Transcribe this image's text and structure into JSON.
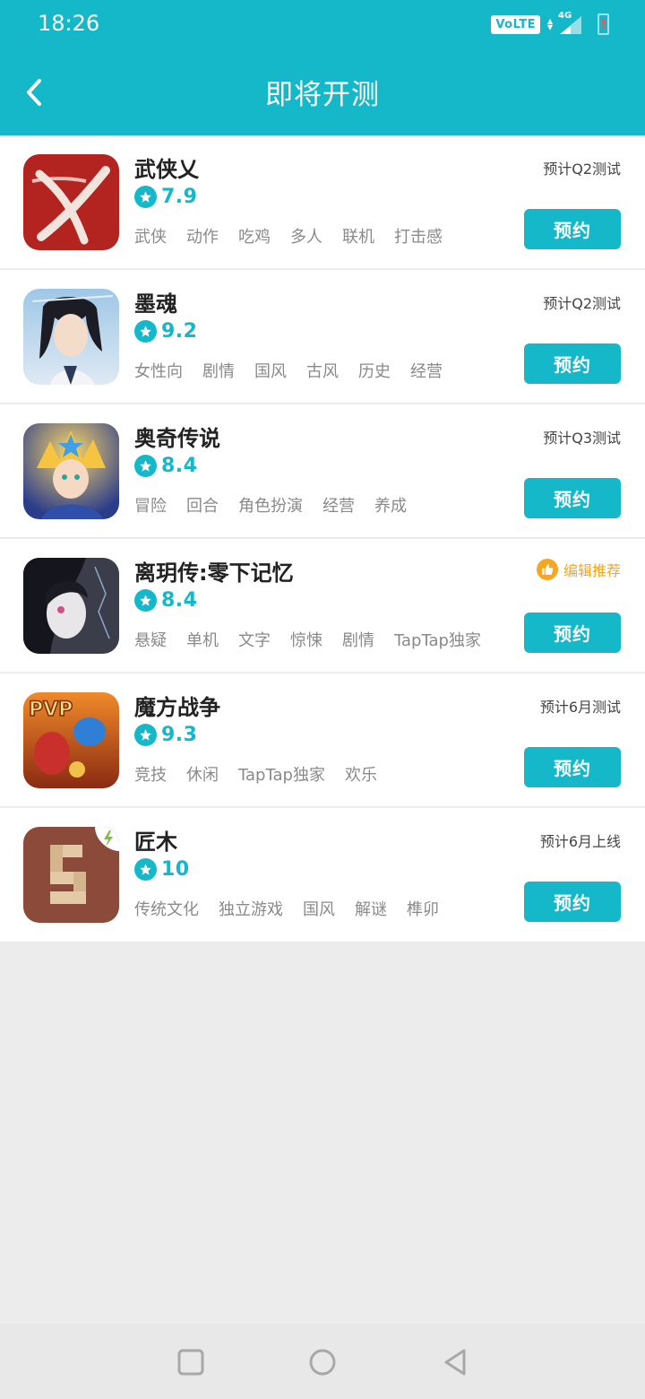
{
  "status_bar": {
    "time": "18:26",
    "volte": "VoLTE",
    "network": "4G",
    "battery_warning": "!"
  },
  "header": {
    "title": "即将开测",
    "back_icon": "chevron-left-icon",
    "background": "#15b8c8"
  },
  "games": [
    {
      "name": "武侠乂",
      "score": "7.9",
      "tags": [
        "武侠",
        "动作",
        "吃鸡",
        "多人",
        "联机",
        "打击感"
      ],
      "test_label": "预计Q2测试",
      "button": "预约"
    },
    {
      "name": "墨魂",
      "score": "9.2",
      "tags": [
        "女性向",
        "剧情",
        "国风",
        "古风",
        "历史",
        "经营"
      ],
      "test_label": "预计Q2测试",
      "button": "预约"
    },
    {
      "name": "奥奇传说",
      "score": "8.4",
      "tags": [
        "冒险",
        "回合",
        "角色扮演",
        "经营",
        "养成"
      ],
      "test_label": "预计Q3测试",
      "button": "预约"
    },
    {
      "name": "离玥传:零下记忆",
      "score": "8.4",
      "tags": [
        "悬疑",
        "单机",
        "文字",
        "惊悚",
        "剧情",
        "TapTap独家"
      ],
      "test_label": "编辑推荐",
      "button": "预约"
    },
    {
      "name": "魔方战争",
      "score": "9.3",
      "tags": [
        "竞技",
        "休闲",
        "TapTap独家",
        "欢乐"
      ],
      "test_label": "预计6月测试",
      "button": "预约"
    },
    {
      "name": "匠木",
      "score": "10",
      "tags": [
        "传统文化",
        "独立游戏",
        "国风",
        "解谜",
        "榫卯"
      ],
      "test_label": "预计6月上线",
      "button": "预约"
    }
  ],
  "icon_art": {
    "pvp_badge": "PVP"
  },
  "colors": {
    "accent": "#15b8c8",
    "recommend": "#f5a623",
    "tag": "#8a8a8a"
  },
  "nav": {
    "recents_icon": "square-icon",
    "home_icon": "circle-icon",
    "back_icon": "triangle-back-icon"
  }
}
